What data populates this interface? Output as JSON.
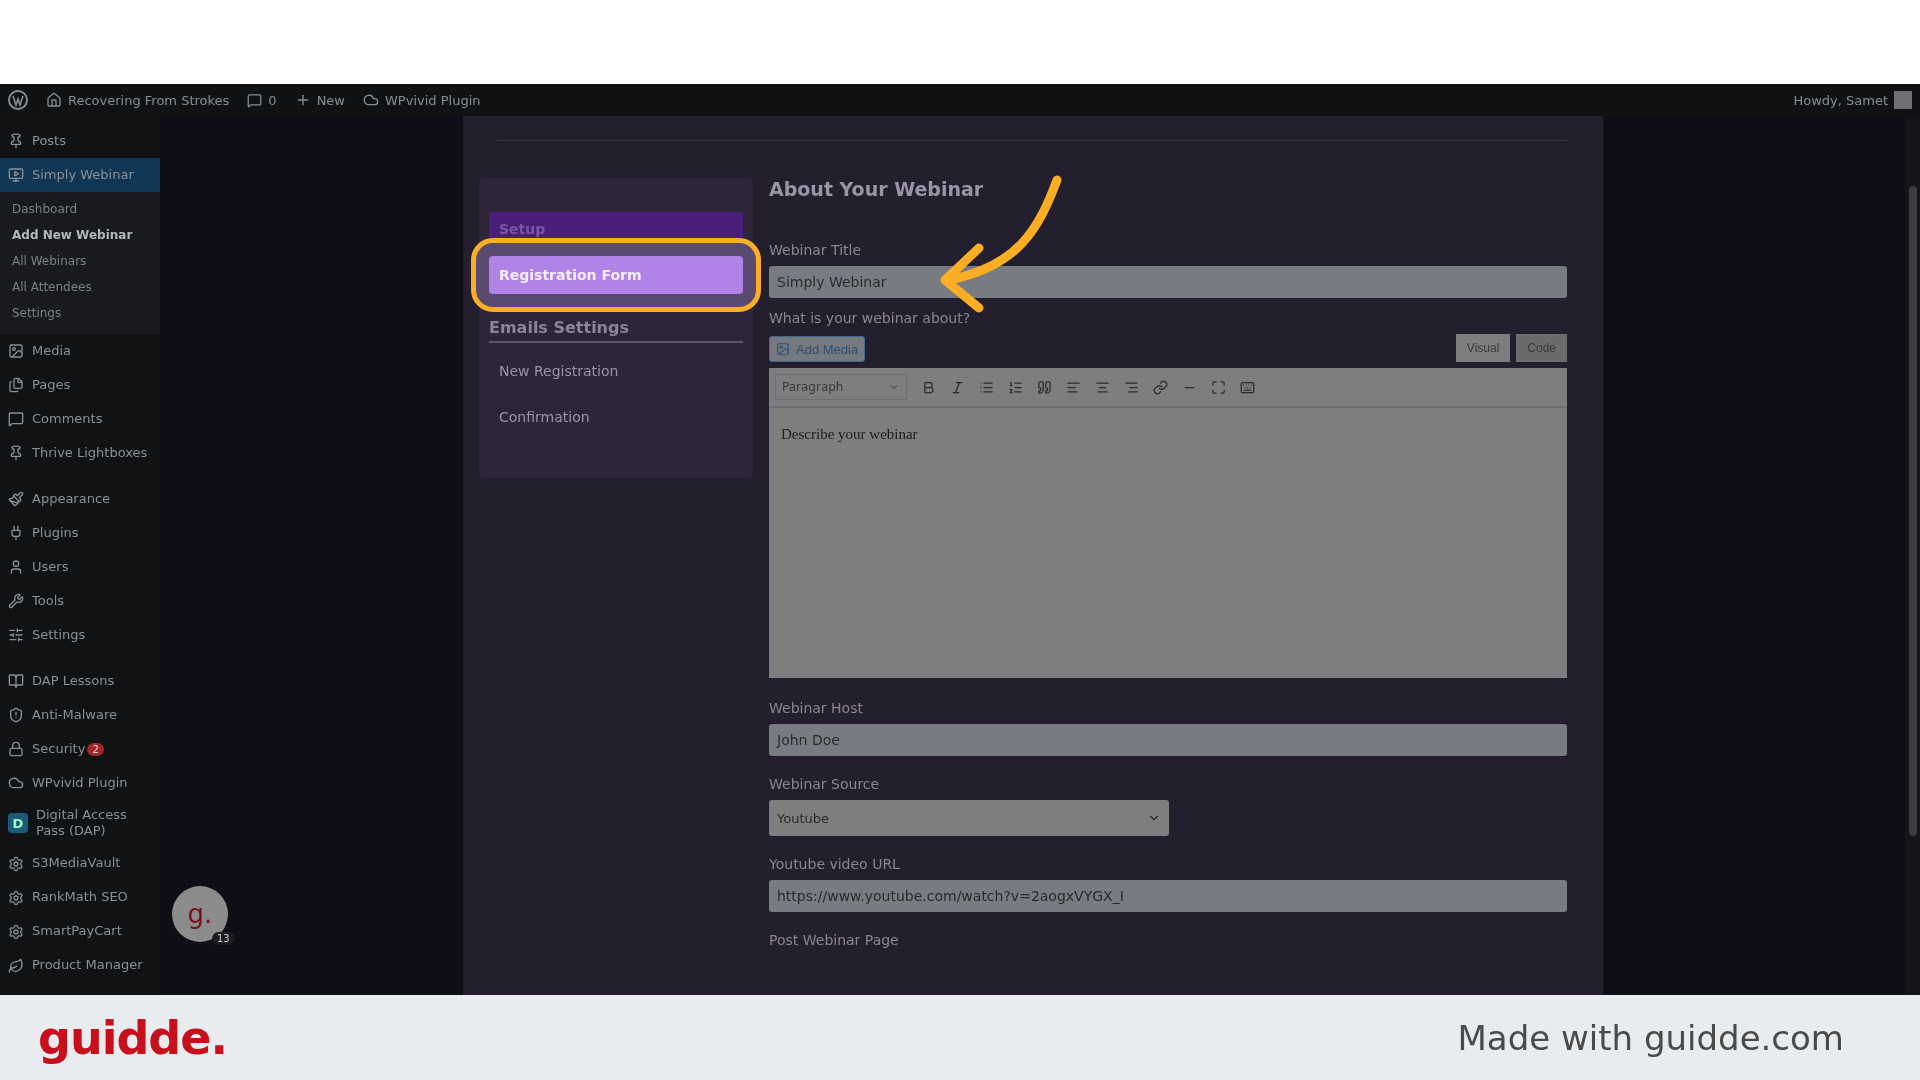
{
  "admin_bar": {
    "site": "Recovering From Strokes",
    "comments": "0",
    "new": "New",
    "plugin": "WPvivid Plugin",
    "greeting": "Howdy, Samet"
  },
  "sidebar": {
    "items": [
      {
        "label": "Posts",
        "selected": false
      },
      {
        "label": "Simply Webinar",
        "selected": true,
        "children": [
          {
            "label": "Dashboard",
            "selected": false
          },
          {
            "label": "Add New Webinar",
            "selected": true
          },
          {
            "label": "All Webinars",
            "selected": false
          },
          {
            "label": "All Attendees",
            "selected": false
          },
          {
            "label": "Settings",
            "selected": false
          }
        ]
      },
      {
        "label": "Media",
        "selected": false
      },
      {
        "label": "Pages",
        "selected": false
      },
      {
        "label": "Comments",
        "selected": false
      },
      {
        "label": "Thrive Lightboxes",
        "selected": false
      },
      {
        "label": "Appearance",
        "selected": false
      },
      {
        "label": "Plugins",
        "selected": false
      },
      {
        "label": "Users",
        "selected": false
      },
      {
        "label": "Tools",
        "selected": false
      },
      {
        "label": "Settings",
        "selected": false
      },
      {
        "label": "DAP Lessons",
        "selected": false
      },
      {
        "label": "Anti-Malware",
        "selected": false
      },
      {
        "label": "Security",
        "selected": false,
        "badge": "2"
      },
      {
        "label": "WPvivid Plugin",
        "selected": false
      },
      {
        "label": "Digital Access Pass (DAP)",
        "selected": false,
        "logo_letter": "D"
      },
      {
        "label": "S3MediaVault",
        "selected": false
      },
      {
        "label": "RankMath SEO",
        "selected": false
      },
      {
        "label": "SmartPayCart",
        "selected": false
      },
      {
        "label": "Product Manager",
        "selected": false
      }
    ]
  },
  "guidde_bubble": {
    "letter": "g.",
    "count": "13"
  },
  "steps": {
    "items": [
      {
        "label": "Setup",
        "selected": false
      },
      {
        "label": "Registration Form",
        "selected": true
      }
    ],
    "section": "Emails Settings",
    "links": [
      "New Registration",
      "Confirmation"
    ]
  },
  "form": {
    "title": "About Your Webinar",
    "title_label": "Webinar Title",
    "title_value": "Simply Webinar",
    "about_label": "What is your webinar about?",
    "add_media": "Add Media",
    "editor_tabs": [
      {
        "label": "Visual",
        "selected": true
      },
      {
        "label": "Code",
        "selected": false
      }
    ],
    "format": "Paragraph",
    "body": "Describe your webinar",
    "host_label": "Webinar Host",
    "host_value": "John Doe",
    "source_label": "Webinar Source",
    "source_value": "Youtube",
    "url_label": "Youtube video URL",
    "url_value": "https://www.youtube.com/watch?v=2aogxVYGX_I",
    "post_label": "Post Webinar Page"
  },
  "footer": {
    "logo": "guidde.",
    "credit": "Made with guidde.com"
  }
}
